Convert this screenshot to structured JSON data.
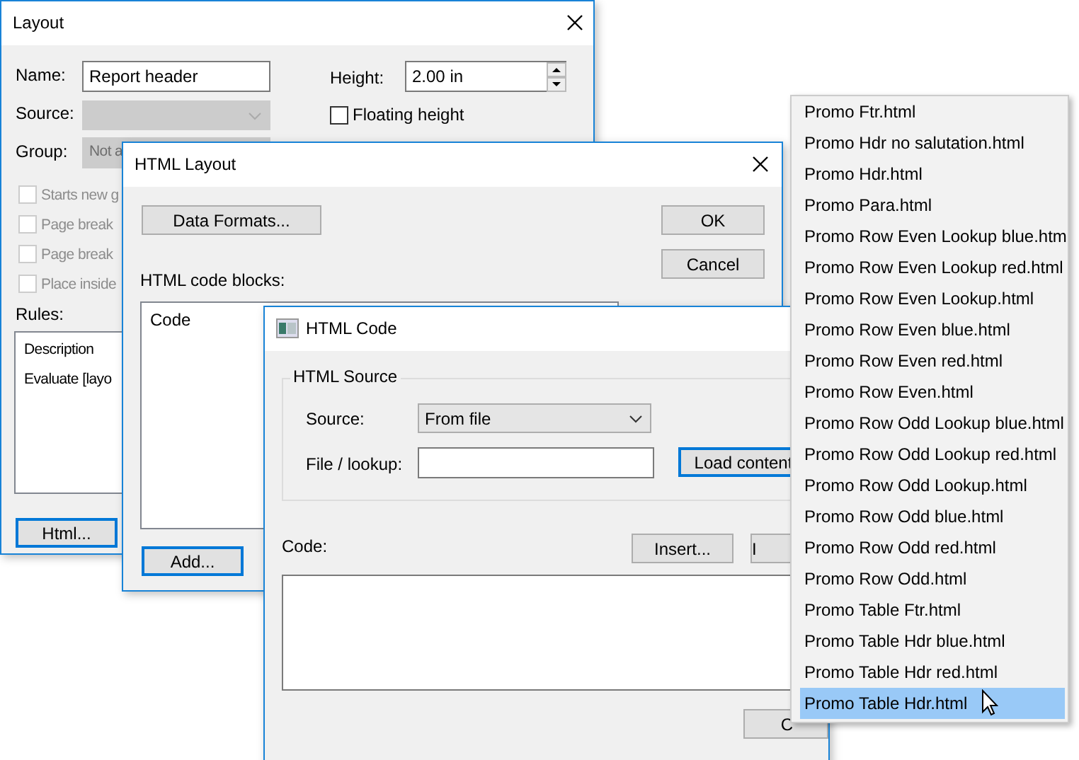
{
  "layout_window": {
    "title": "Layout",
    "name_label": "Name:",
    "name_value": "Report header",
    "height_label": "Height:",
    "height_value": "2.00 in",
    "floating_height": {
      "label": "Floating height",
      "checked": false
    },
    "source_label": "Source:",
    "group_label": "Group:",
    "group_value": "Not a",
    "checkboxes": [
      {
        "label": "Starts new g",
        "checked": false,
        "disabled": true
      },
      {
        "label": "Page break",
        "checked": false,
        "disabled": true
      },
      {
        "label": "Page break",
        "checked": false,
        "disabled": true
      },
      {
        "label": "Place inside",
        "checked": false,
        "disabled": true
      }
    ],
    "rules_label": "Rules:",
    "rules": [
      "Description",
      "Evaluate [layo"
    ],
    "html_button": "Html..."
  },
  "html_layout_window": {
    "title": "HTML Layout",
    "data_formats_button": "Data Formats...",
    "ok_button": "OK",
    "cancel_button": "Cancel",
    "code_blocks_label": "HTML code blocks:",
    "code_blocks": [
      "Code"
    ],
    "add_button": "Add..."
  },
  "html_code_window": {
    "title": "HTML Code",
    "group_title": "HTML Source",
    "source_label": "Source:",
    "source_value": "From file",
    "file_label": "File / lookup:",
    "load_button": "Load content",
    "code_label": "Code:",
    "insert_button": "Insert...",
    "second_button": "I",
    "bottom_button": "C"
  },
  "dropdown": {
    "items": [
      {
        "label": "Promo Ftr.html",
        "selected": false
      },
      {
        "label": "Promo Hdr no salutation.html",
        "selected": false
      },
      {
        "label": "Promo Hdr.html",
        "selected": false
      },
      {
        "label": "Promo Para.html",
        "selected": false
      },
      {
        "label": "Promo Row Even Lookup blue.htm",
        "selected": false
      },
      {
        "label": "Promo Row Even Lookup red.html",
        "selected": false
      },
      {
        "label": "Promo Row Even Lookup.html",
        "selected": false
      },
      {
        "label": "Promo Row Even blue.html",
        "selected": false
      },
      {
        "label": "Promo Row Even red.html",
        "selected": false
      },
      {
        "label": "Promo Row Even.html",
        "selected": false
      },
      {
        "label": "Promo Row Odd Lookup blue.html",
        "selected": false
      },
      {
        "label": "Promo Row Odd Lookup red.html",
        "selected": false
      },
      {
        "label": "Promo Row Odd Lookup.html",
        "selected": false
      },
      {
        "label": "Promo Row Odd blue.html",
        "selected": false
      },
      {
        "label": "Promo Row Odd red.html",
        "selected": false
      },
      {
        "label": "Promo Row Odd.html",
        "selected": false
      },
      {
        "label": "Promo Table Ftr.html",
        "selected": false
      },
      {
        "label": "Promo Table Hdr blue.html",
        "selected": false
      },
      {
        "label": "Promo Table Hdr red.html",
        "selected": false
      },
      {
        "label": "Promo Table Hdr.html",
        "selected": true
      }
    ]
  }
}
